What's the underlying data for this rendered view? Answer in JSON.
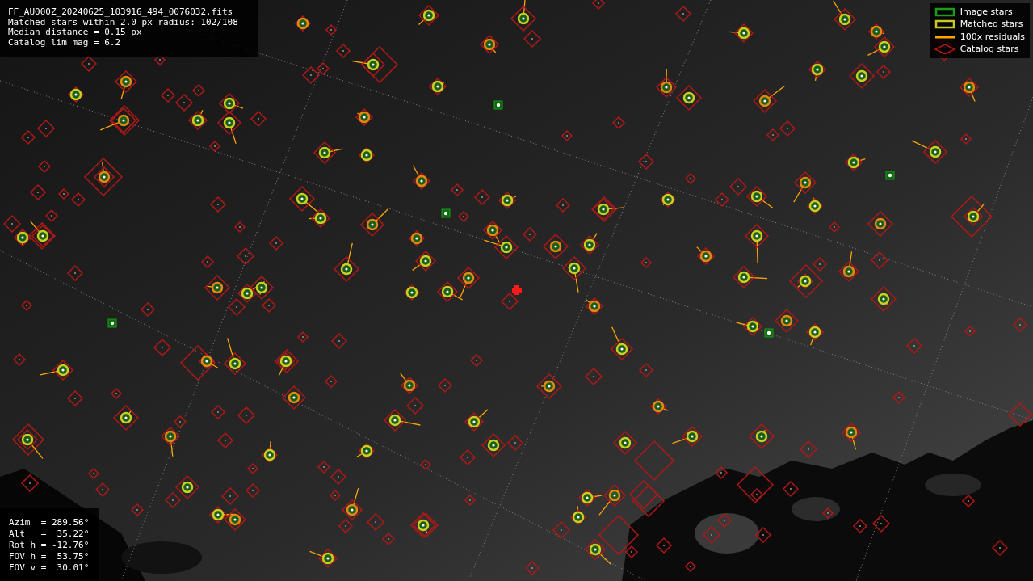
{
  "info_box": {
    "lines": [
      "FF_AU000Z_20240625_103916_494_0076032.fits",
      "Matched stars within 2.0 px radius: 102/108",
      "Median distance = 0.15 px",
      "Catalog lim mag = 6.2"
    ]
  },
  "legend": [
    {
      "kind": "box",
      "label": "Image stars",
      "color": "#1f9a1f"
    },
    {
      "kind": "box",
      "label": "Matched stars",
      "color": "#c8c820"
    },
    {
      "kind": "line",
      "label": "100x residuals",
      "color": "#ffa500"
    },
    {
      "kind": "diamond",
      "label": "Catalog stars",
      "color": "#b01818"
    }
  ],
  "pointing_box": {
    "lines": [
      "Azim  = 289.56°",
      "Alt   =  35.22°",
      "Rot h = -12.76°",
      "FOV h =  53.75°",
      "FOV v =  30.01°"
    ]
  }
}
